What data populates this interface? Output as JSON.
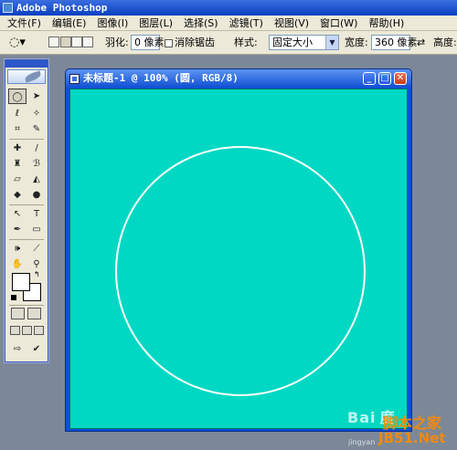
{
  "app": {
    "title": "Adobe Photoshop"
  },
  "menu": [
    "文件(F)",
    "编辑(E)",
    "图像(I)",
    "图层(L)",
    "选择(S)",
    "滤镜(T)",
    "视图(V)",
    "窗口(W)",
    "帮助(H)"
  ],
  "options": {
    "feather_label": "羽化:",
    "feather_value": "0 像素",
    "antialias_label": "消除锯齿",
    "style_label": "样式:",
    "style_value": "固定大小",
    "width_label": "宽度:",
    "width_value": "360 像素",
    "swap_symbol": "⇄",
    "height_label": "高度:"
  },
  "document": {
    "title": "未标题-1 @ 100% (圆, RGB/8)",
    "canvas_color": "#00d8c4",
    "circle_color": "#ffffff"
  },
  "tools": {
    "icons": [
      "marquee-ellipse-icon",
      "move-icon",
      "lasso-icon",
      "magic-wand-icon",
      "crop-icon",
      "slice-icon",
      "healing-icon",
      "brush-icon",
      "stamp-icon",
      "history-brush-icon",
      "eraser-icon",
      "paint-bucket-icon",
      "blur-icon",
      "dodge-icon",
      "path-select-icon",
      "type-icon",
      "pen-icon",
      "shape-icon",
      "notes-icon",
      "eyedropper-icon",
      "hand-icon",
      "zoom-icon"
    ],
    "foreground": "#ffffff",
    "background": "#ffffff"
  },
  "watermark": {
    "baidu": "Bai 度",
    "jingyan": "jingyan",
    "site_cn": "脚本之家",
    "site": "JB51.Net"
  }
}
